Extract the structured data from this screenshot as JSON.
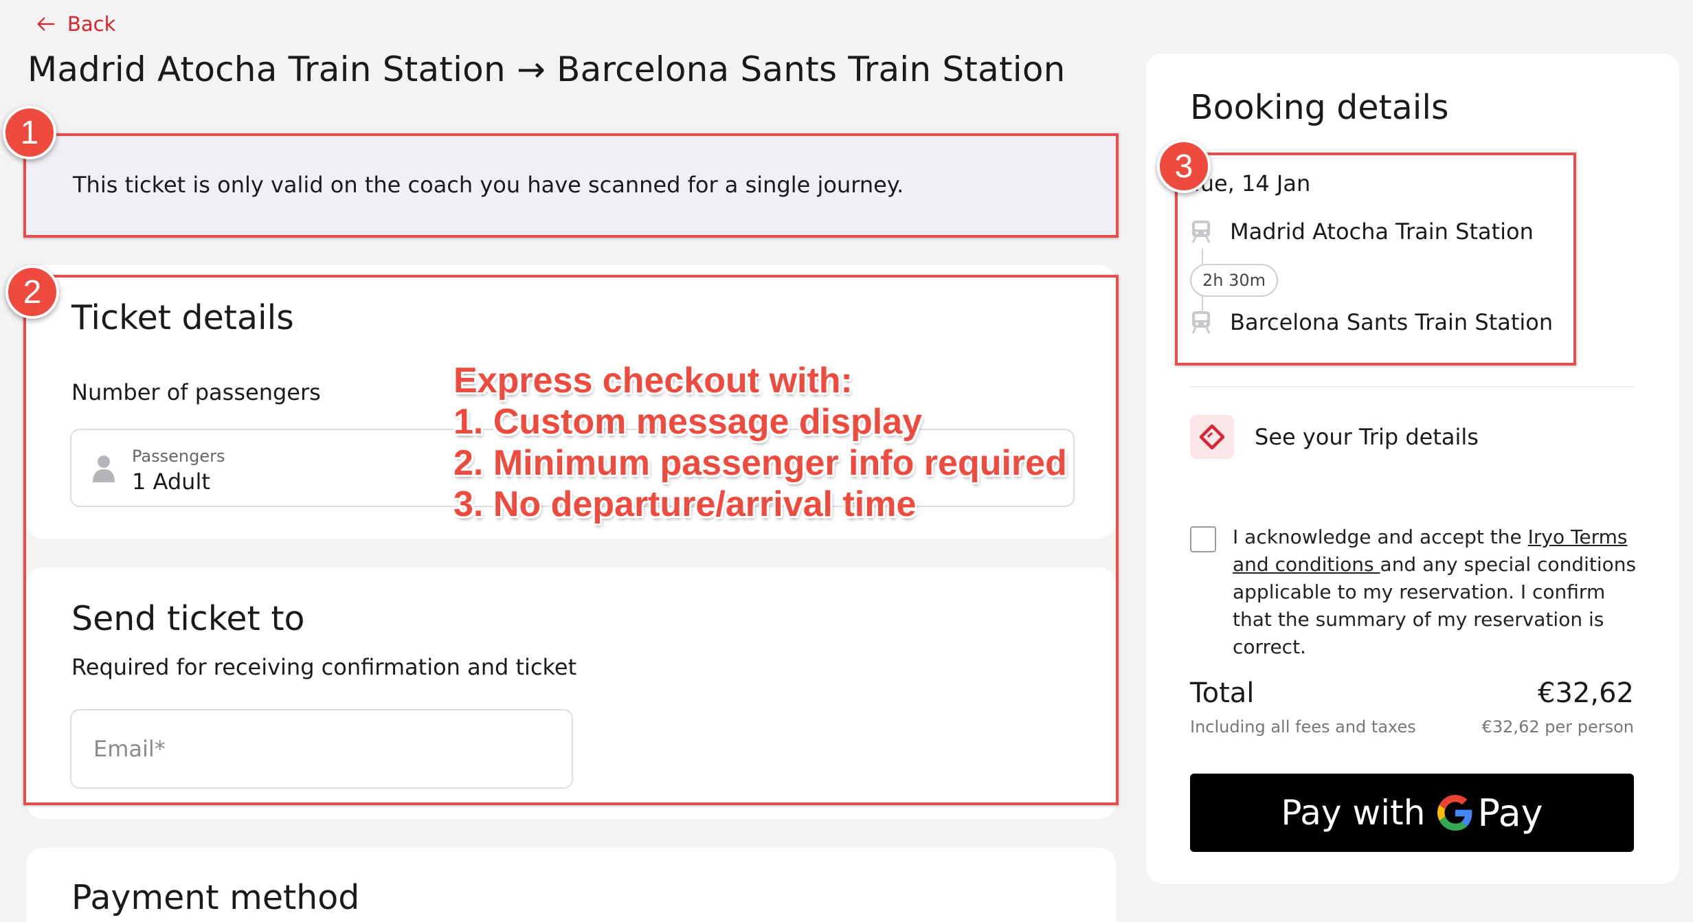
{
  "nav": {
    "back_label": "Back"
  },
  "route": {
    "title": "Madrid Atocha Train Station → Barcelona Sants Train Station"
  },
  "notice": {
    "text": "This ticket is only valid on the coach you have scanned for a single journey."
  },
  "ticket_details": {
    "title": "Ticket details",
    "passengers_label": "Number of passengers",
    "passengers_caption": "Passengers",
    "passengers_value": "1 Adult"
  },
  "send_ticket": {
    "title": "Send ticket to",
    "subtitle": "Required for receiving confirmation and ticket",
    "email_placeholder": "Email*"
  },
  "payment": {
    "title": "Payment method"
  },
  "booking": {
    "title": "Booking details",
    "date": "Tue, 14 Jan",
    "from_station": "Madrid Atocha Train Station",
    "duration": "2h 30m",
    "to_station": "Barcelona Sants Train Station",
    "trip_details_label": "See your Trip details",
    "terms_prefix": "I acknowledge and accept the ",
    "terms_link": "Iryo Terms and conditions ",
    "terms_suffix": "and any special conditions applicable to my reservation. I confirm that the summary of my reservation is correct.",
    "total_label": "Total",
    "total_price": "€32,62",
    "fees_note": "Including all fees and taxes",
    "per_person": "€32,62 per person",
    "pay_button_text": "Pay with",
    "pay_button_brand": "Pay"
  },
  "annotations": {
    "markers": [
      "1",
      "2",
      "3"
    ],
    "lines": [
      "Express checkout with:",
      "1. Custom message display",
      "2. Minimum passenger info required",
      "3. No departure/arrival time"
    ]
  },
  "colors": {
    "accent": "#d9232f",
    "annotation": "#ef4a3e",
    "notice_bg": "#efeff6",
    "page_bg": "#f3f3f4"
  },
  "icons": {
    "back": "arrow-left-icon",
    "person": "person-icon",
    "chevron": "chevron-down-icon",
    "train": "train-icon",
    "ticket": "ticket-icon",
    "google": "google-g-icon"
  }
}
